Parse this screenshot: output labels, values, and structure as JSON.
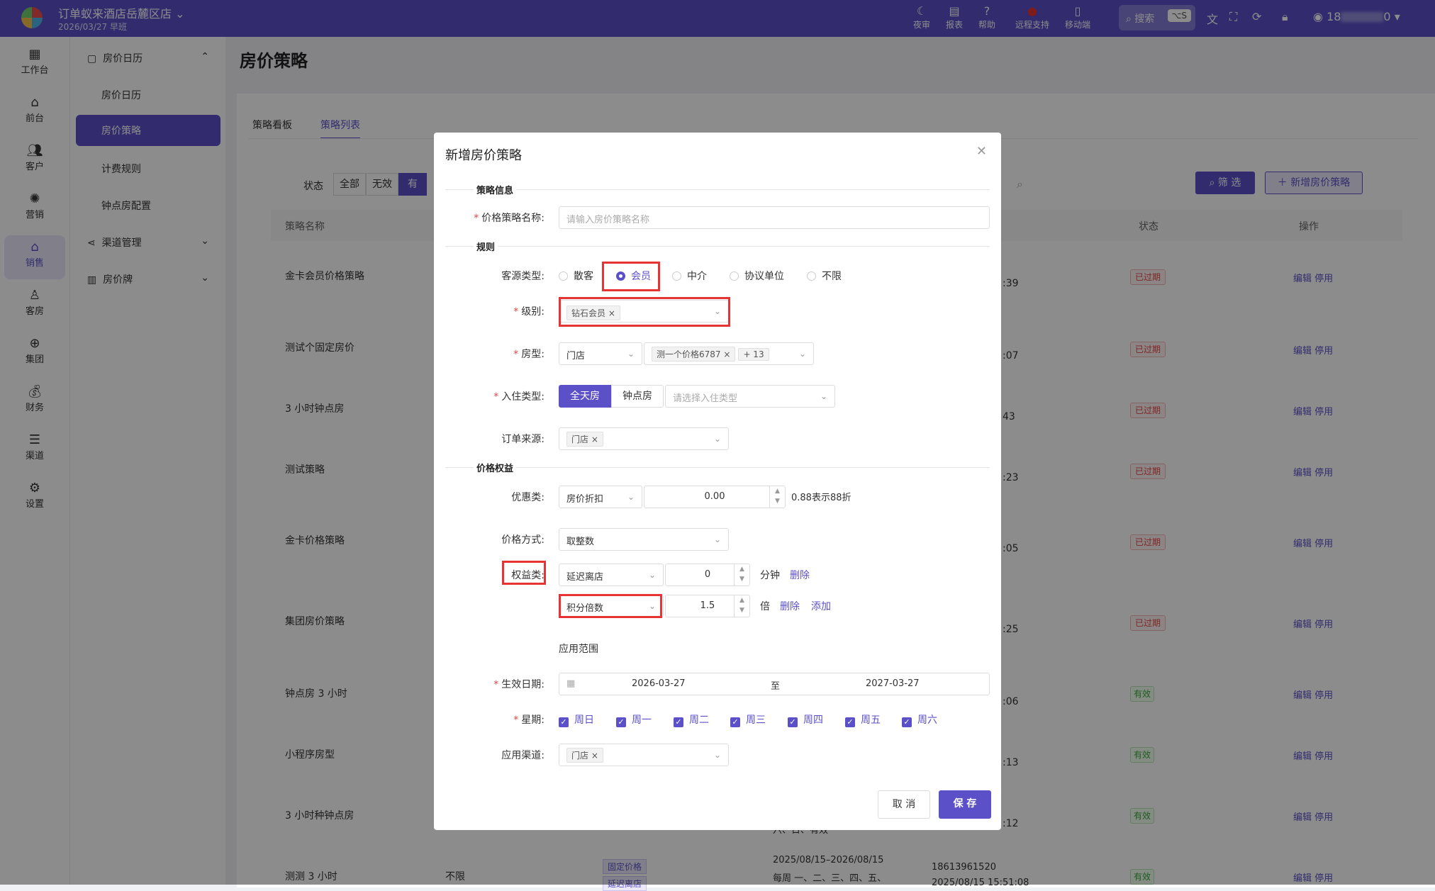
{
  "topbar": {
    "hotel_name": "订单蚁来酒店岳麓区店",
    "date_shift": "2026/03/27 早班",
    "items": [
      "夜审",
      "报表",
      "帮助",
      "远程支持",
      "移动端"
    ],
    "search_label": "搜索",
    "search_shortcut": "⌥S",
    "user": "18",
    "user_tail": "0"
  },
  "sidebar": {
    "items": [
      "工作台",
      "前台",
      "客户",
      "营销",
      "销售",
      "客房",
      "集团",
      "财务",
      "渠道",
      "设置"
    ]
  },
  "subnav": {
    "group1": "房价日历",
    "items": [
      "房价日历",
      "房价策略",
      "计费规则",
      "钟点房配置"
    ],
    "group2": "渠道管理",
    "group3": "房价牌"
  },
  "page": {
    "title": "房价策略",
    "tabs": [
      "策略看板",
      "策略列表"
    ],
    "status_label": "状态",
    "status_filters": [
      "全部",
      "无效",
      "有"
    ],
    "filter_btn": "筛 选",
    "add_btn": "新增房价策略",
    "columns": {
      "name": "策略名称",
      "status": "状态",
      "ops": "操作"
    },
    "rows": [
      {
        "name": "金卡会员价格策略",
        "time_tail": ":39",
        "status": "已过期"
      },
      {
        "name": "测试个固定房价",
        "time_tail": ":07",
        "status": "已过期"
      },
      {
        "name": "3 小时钟点房",
        "time_tail": "43",
        "status": "已过期"
      },
      {
        "name": "测试策略",
        "time_tail": ":23",
        "status": "已过期"
      },
      {
        "name": "金卡价格策略",
        "time_tail": ":05",
        "status": "已过期"
      },
      {
        "name": "集团房价策略",
        "time_tail": ":25",
        "status": "已过期"
      },
      {
        "name": "钟点房 3 小时",
        "time_tail": ":06",
        "status": "有效"
      },
      {
        "name": "小程序房型",
        "time_tail": ":13",
        "status": "有效"
      },
      {
        "name": "3 小时种钟点房",
        "time_tail": ":12",
        "status": "有效"
      },
      {
        "name": "测测 3 小时",
        "time_tail": "",
        "status": "有效"
      }
    ],
    "row_edit": "编辑",
    "row_stop": "停用",
    "last_row": {
      "scope": "不限",
      "tag": "固定价格",
      "tag2": "延迟离店",
      "dates": "2025/08/15–2026/08/15",
      "weekdays": "每周 一、二、三、四、五、",
      "weekdays_prev": "六、日、有效",
      "phone": "18613961520",
      "created": "2025/08/15 15:51:08"
    }
  },
  "modal": {
    "title": "新增房价策略",
    "sections": {
      "info": "策略信息",
      "rules": "规则",
      "benefits": "价格权益"
    },
    "name_label": "价格策略名称:",
    "name_placeholder": "请输入房价策略名称",
    "source_label": "客源类型:",
    "source_options": [
      "散客",
      "会员",
      "中介",
      "协议单位",
      "不限"
    ],
    "level_label": "级别:",
    "level_tag": "钻石会员",
    "room_label": "房型:",
    "room_store": "门店",
    "room_tag": "测一个价格6787",
    "room_more": "+ 13",
    "checkin_label": "入住类型:",
    "checkin_options": [
      "全天房",
      "钟点房"
    ],
    "checkin_placeholder": "请选择入住类型",
    "order_source_label": "订单来源:",
    "order_source_tag": "门店",
    "discount_label": "优惠类:",
    "discount_type": "房价折扣",
    "discount_value": "0.00",
    "discount_hint": "0.88表示88折",
    "price_mode_label": "价格方式:",
    "price_mode": "取整数",
    "benefit_label": "权益类:",
    "benefit1_type": "延迟离店",
    "benefit1_value": "0",
    "benefit1_unit": "分钟",
    "benefit2_type": "积分倍数",
    "benefit2_value": "1.5",
    "benefit2_unit": "倍",
    "delete_label": "删除",
    "add_label": "添加",
    "scope_title": "应用范围",
    "date_label": "生效日期:",
    "date_start": "2026-03-27",
    "date_to": "至",
    "date_end": "2027-03-27",
    "week_label": "星期:",
    "weekdays": [
      "周日",
      "周一",
      "周二",
      "周三",
      "周四",
      "周五",
      "周六"
    ],
    "channel_label": "应用渠道:",
    "channel_tag": "门店",
    "cancel": "取 消",
    "save": "保 存"
  },
  "colors": {
    "accent": "#5b50c8",
    "highlight": "#e63434",
    "expired": "#e64545",
    "valid": "#3aa83a"
  }
}
